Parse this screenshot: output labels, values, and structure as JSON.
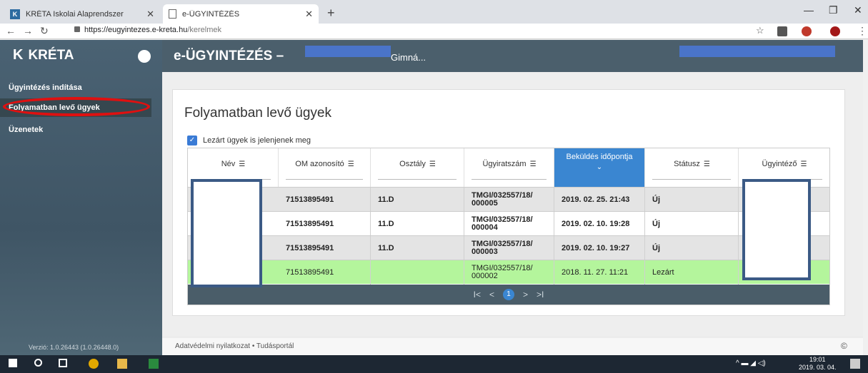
{
  "browser": {
    "tabs": [
      {
        "title": "KRÉTA Iskolai Alaprendszer",
        "active": false
      },
      {
        "title": "e-ÜGYINTÉZÉS",
        "active": true
      }
    ],
    "url_host": "https://eugyintezes.e-kreta.hu",
    "url_path": "/kerelmek"
  },
  "sidebar": {
    "brand": "KRÉTA",
    "items": [
      {
        "label": "Ügyintézés indítása"
      },
      {
        "label": "Folyamatban levő ügyek"
      },
      {
        "label": "Üzenetek"
      }
    ],
    "version": "Verzió: 1.0.26443 (1.0.26448.0)"
  },
  "header": {
    "title": "e-ÜGYINTÉZÉS –",
    "school_fragment": "Gimná..."
  },
  "main": {
    "title": "Folyamatban levő ügyek",
    "checkbox_label": "Lezárt ügyek is jelenjenek meg",
    "columns": [
      "Név",
      "OM azonosító",
      "Osztály",
      "Ügyiratszám",
      "Beküldés időpontja",
      "Státusz",
      "Ügyintéző"
    ],
    "rows": [
      {
        "om": "71513895491",
        "class": "11.D",
        "case": "TMGI/032557/18/ 000005",
        "sent": "2019. 02. 25. 21:43",
        "status": "Új"
      },
      {
        "om": "71513895491",
        "class": "11.D",
        "case": "TMGI/032557/18/ 000004",
        "sent": "2019. 02. 10. 19:28",
        "status": "Új"
      },
      {
        "om": "71513895491",
        "class": "11.D",
        "case": "TMGI/032557/18/ 000003",
        "sent": "2019. 02. 10. 19:27",
        "status": "Új"
      },
      {
        "om": "71513895491",
        "class": "",
        "case": "TMGI/032557/18/ 000002",
        "sent": "2018. 11. 27. 11:21",
        "status": "Lezárt"
      }
    ],
    "pager": {
      "first": "I<",
      "prev": "<",
      "page": "1",
      "next": ">",
      "last": ">I"
    }
  },
  "footer": {
    "links": "Adatvédelmi nyilatkozat • Tudásportál",
    "copyright": "©"
  },
  "taskbar": {
    "time": "19:01",
    "date": "2019. 03. 04."
  }
}
